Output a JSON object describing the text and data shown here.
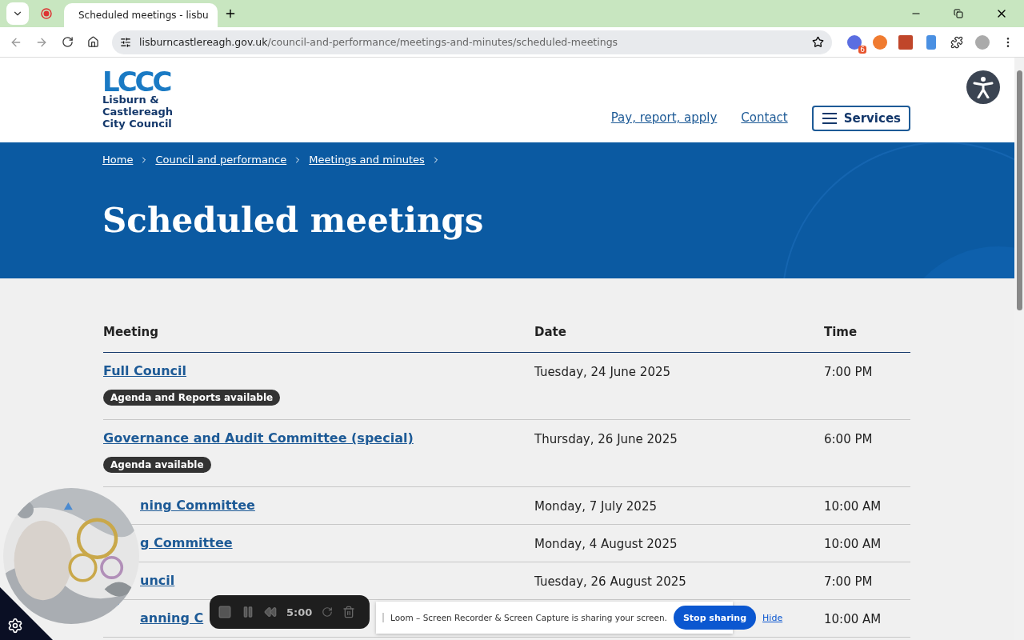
{
  "browser": {
    "tab_title": "Scheduled meetings - lisbu",
    "url_domain": "lisburncastlereagh.gov.uk",
    "url_path": "/council-and-performance/meetings-and-minutes/scheduled-meetings",
    "extension_badge": "6"
  },
  "header": {
    "logo_mark": "LCCC",
    "logo_lines": [
      "Lisburn &",
      "Castlereagh",
      "City Council"
    ],
    "nav": [
      "Pay, report, apply",
      "Contact"
    ],
    "services": "Services"
  },
  "breadcrumb": [
    "Home",
    "Council and performance",
    "Meetings and minutes"
  ],
  "title": "Scheduled meetings",
  "table": {
    "columns": [
      "Meeting",
      "Date",
      "Time"
    ],
    "rows": [
      {
        "title": "Full Council",
        "badge": "Agenda and Reports available",
        "date": "Tuesday, 24 June 2025",
        "time": "7:00 PM",
        "covered": false
      },
      {
        "title": "Governance and Audit Committee (special)",
        "badge": "Agenda available",
        "date": "Thursday, 26 June 2025",
        "time": "6:00 PM",
        "covered": false
      },
      {
        "title": "ning Committee",
        "date": "Monday, 7 July 2025",
        "time": "10:00 AM",
        "covered": true
      },
      {
        "title": "g Committee",
        "date": "Monday, 4 August 2025",
        "time": "10:00 AM",
        "covered": true
      },
      {
        "title": "uncil",
        "date": "Tuesday, 26 August 2025",
        "time": "7:00 PM",
        "covered": true
      },
      {
        "title": "anning C",
        "date": "",
        "time": "10:00 AM",
        "covered": true
      }
    ]
  },
  "recorder": {
    "timer": "5:00"
  },
  "share_banner": {
    "text": "Loom – Screen Recorder & Screen Capture is sharing your screen.",
    "button": "Stop sharing",
    "link": "Hide"
  }
}
